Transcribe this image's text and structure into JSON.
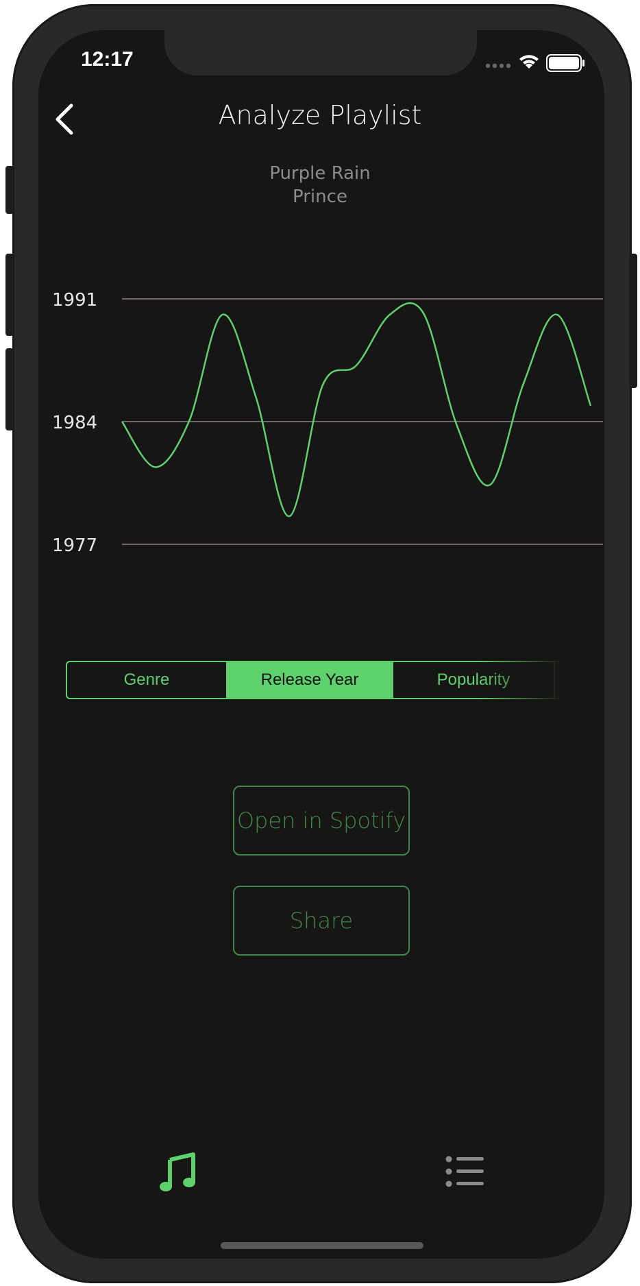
{
  "status_bar": {
    "time": "12:17"
  },
  "header": {
    "title": "Analyze Playlist",
    "back_icon": "chevron-left-icon"
  },
  "now_playing": {
    "track": "Purple Rain",
    "artist": "Prince"
  },
  "chart_data": {
    "type": "line",
    "y_ticks": [
      "1991",
      "1984",
      "1977"
    ],
    "ylim": [
      1977,
      1991
    ],
    "series": [
      {
        "values": [
          1984,
          1981.4,
          1984,
          1990.1,
          1985.4,
          1978.6,
          1986.1,
          1987.2,
          1990.1,
          1990.2,
          1983.8,
          1980.4,
          1986.2,
          1990.1,
          1984.9
        ]
      }
    ],
    "grid": true,
    "line_color": "#5ed16e"
  },
  "segments": {
    "items": [
      {
        "label": "Genre",
        "active": false
      },
      {
        "label": "Release Year",
        "active": true
      },
      {
        "label": "Popularity",
        "active": false
      }
    ]
  },
  "actions": {
    "open_spotify": "Open in Spotify",
    "share": "Share"
  },
  "tab_bar": {
    "items": [
      {
        "icon": "music-note-icon",
        "active": true
      },
      {
        "icon": "list-icon",
        "active": false
      }
    ]
  },
  "colors": {
    "accent": "#5ed16e",
    "muted_accent": "#3f8a4b",
    "background": "#181515"
  }
}
